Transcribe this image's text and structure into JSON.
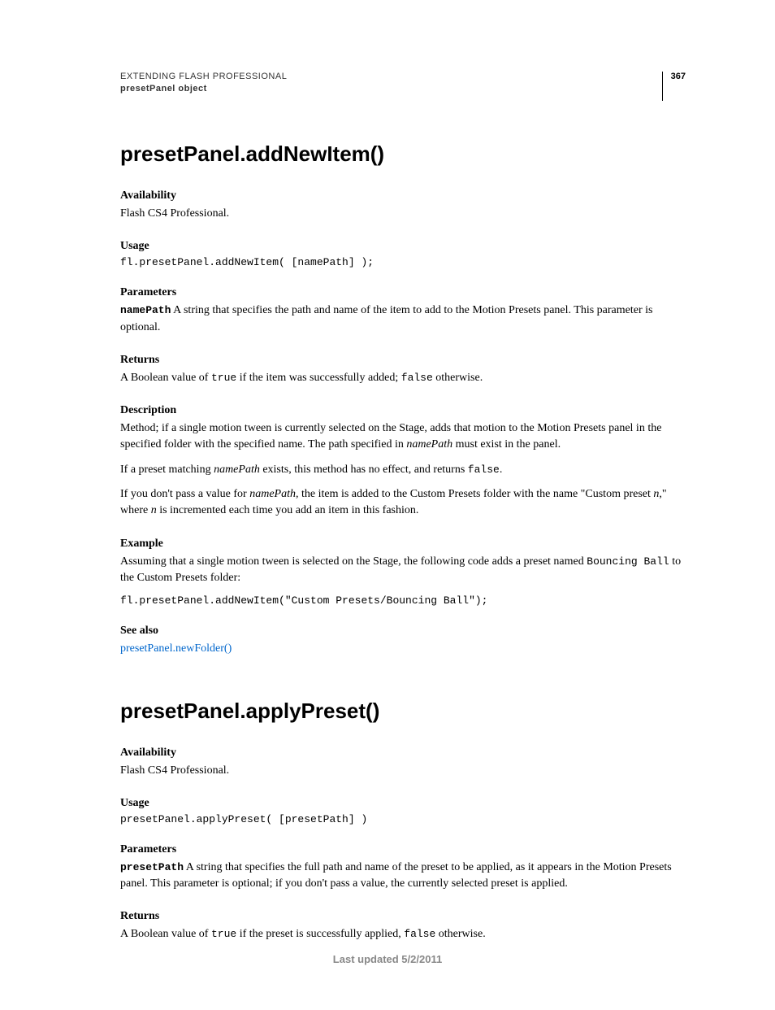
{
  "header": {
    "title": "EXTENDING FLASH PROFESSIONAL",
    "subtitle": "presetPanel object",
    "pageNumber": "367"
  },
  "method1": {
    "title": "presetPanel.addNewItem()",
    "availability": {
      "heading": "Availability",
      "text": "Flash CS4 Professional."
    },
    "usage": {
      "heading": "Usage",
      "code": "fl.presetPanel.addNewItem( [namePath] );"
    },
    "parameters": {
      "heading": "Parameters",
      "paramName": "namePath",
      "paramDesc": "  A string that specifies the path and name of the item to add to the Motion Presets panel. This parameter is optional."
    },
    "returns": {
      "heading": "Returns",
      "pre": "A Boolean value of ",
      "true": "true",
      "mid": " if the item was successfully added; ",
      "false": "false",
      "post": " otherwise."
    },
    "description": {
      "heading": "Description",
      "p1a": "Method; if a single motion tween is currently selected on the Stage, adds that motion to the Motion Presets panel in the specified folder with the specified name. The path specified in ",
      "p1i": "namePath",
      "p1b": " must exist in the panel.",
      "p2a": "If a preset matching ",
      "p2i": "namePath",
      "p2b": " exists, this method has no effect, and returns ",
      "p2c": "false",
      "p2d": ".",
      "p3a": "If you don't pass a value for ",
      "p3i": "namePath",
      "p3b": ", the item is added to the Custom Presets folder with the name \"Custom preset ",
      "p3n": "n",
      "p3c": ",\" where ",
      "p3n2": "n",
      "p3d": " is incremented each time you add an item in this fashion."
    },
    "example": {
      "heading": "Example",
      "text1": "Assuming that a single motion tween is selected on the Stage, the following code adds a preset named ",
      "code1": "Bouncing Ball",
      "text2": " to the Custom Presets folder:",
      "codeBlock": "fl.presetPanel.addNewItem(\"Custom Presets/Bouncing Ball\");"
    },
    "seealso": {
      "heading": "See also",
      "link": "presetPanel.newFolder()"
    }
  },
  "method2": {
    "title": "presetPanel.applyPreset()",
    "availability": {
      "heading": "Availability",
      "text": "Flash CS4 Professional."
    },
    "usage": {
      "heading": "Usage",
      "code": "presetPanel.applyPreset( [presetPath] )"
    },
    "parameters": {
      "heading": "Parameters",
      "paramName": "presetPath",
      "paramDesc": "  A string that specifies the full path and name of the preset to be applied, as it appears in the Motion Presets panel. This parameter is optional; if you don't pass a value, the currently selected preset is applied."
    },
    "returns": {
      "heading": "Returns",
      "pre": "A Boolean value of ",
      "true": "true",
      "mid": " if the preset is successfully applied, ",
      "false": "false",
      "post": " otherwise."
    }
  },
  "footer": "Last updated 5/2/2011"
}
